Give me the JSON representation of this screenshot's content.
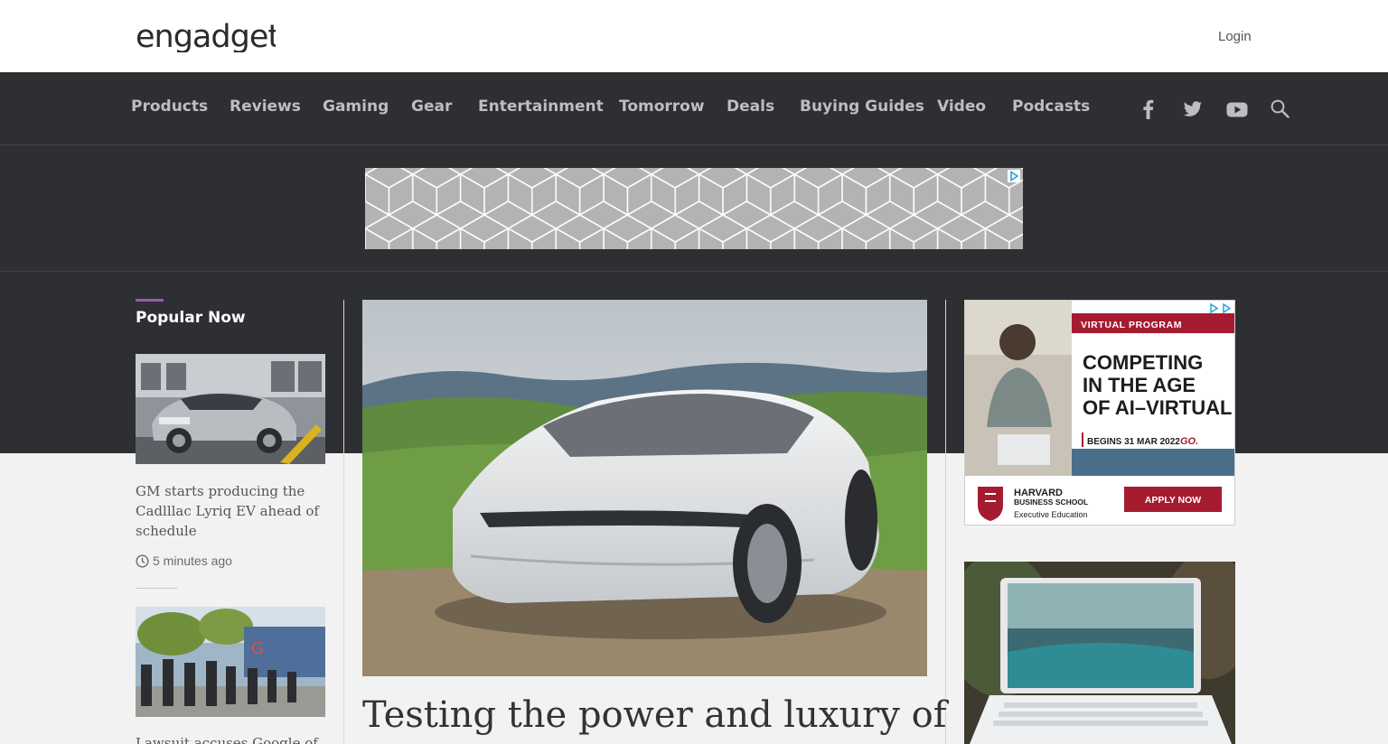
{
  "header": {
    "logo_text": "engadget",
    "login_label": "Login"
  },
  "nav": {
    "items": [
      {
        "label": "Products"
      },
      {
        "label": "Reviews"
      },
      {
        "label": "Gaming"
      },
      {
        "label": "Gear"
      },
      {
        "label": "Entertainment"
      },
      {
        "label": "Tomorrow"
      },
      {
        "label": "Deals"
      },
      {
        "label": "Buying Guides"
      },
      {
        "label": "Video"
      },
      {
        "label": "Podcasts"
      }
    ],
    "icons": [
      "facebook-icon",
      "twitter-icon",
      "youtube-icon",
      "search-icon"
    ]
  },
  "sidebar": {
    "title": "Popular Now",
    "stories": [
      {
        "title": "GM starts producing the Cadlllac Lyriq EV ahead of schedule",
        "time": "5 minutes ago"
      },
      {
        "title": "Lawsuit accuses Google of"
      }
    ]
  },
  "lead": {
    "headline": "Testing the power and luxury of"
  },
  "ad_right": {
    "tag": "VIRTUAL PROGRAM",
    "heading_line1": "COMPETING",
    "heading_line2": "IN THE AGE",
    "heading_line3": "OF AI–VIRTUAL",
    "date": "BEGINS 31 MAR 2022",
    "go": "GO.",
    "school_line1": "HARVARD",
    "school_line2": "BUSINESS SCHOOL",
    "school_line3": "Executive Education",
    "cta": "APPLY NOW"
  },
  "colors": {
    "nav_bg": "#2e2f33",
    "accent": "#9b59b6",
    "ad_red": "#a51c30"
  }
}
